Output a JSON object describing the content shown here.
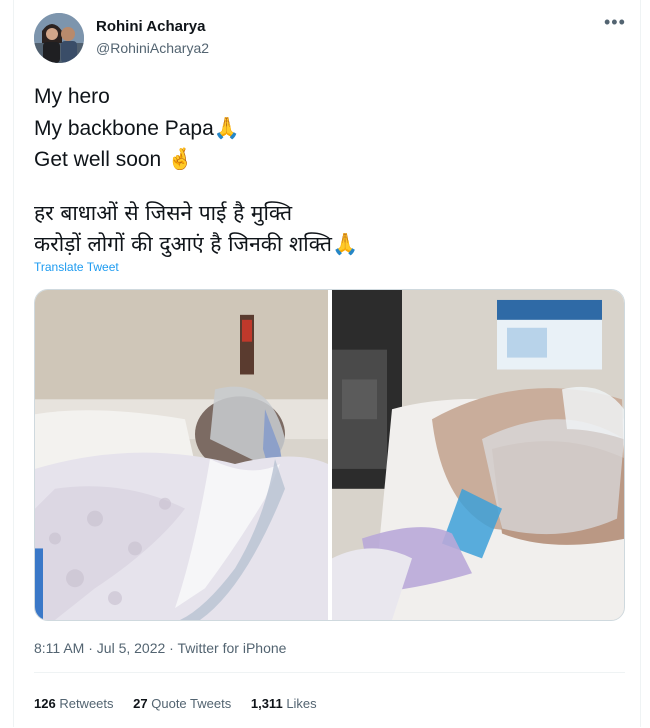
{
  "author": {
    "name": "Rohini Acharya",
    "handle": "@RohiniAcharya2"
  },
  "tweet": {
    "lines": [
      "My hero",
      "My backbone Papa",
      "Get well soon"
    ],
    "emoji": [
      "🙏",
      "🤞"
    ],
    "hindi_lines": [
      "हर बाधाओं से जिसने पाई है मुक्ति",
      "करोड़ों लोगों की दुआएं है जिनकी शक्ति"
    ],
    "hindi_emoji": "🙏",
    "translate_label": "Translate Tweet"
  },
  "meta": {
    "time": "8:11 AM",
    "date": "Jul 5, 2022",
    "sep": "·",
    "source": "Twitter for iPhone"
  },
  "stats": {
    "retweets": "126",
    "retweets_label": "Retweets",
    "quotes": "27",
    "quotes_label": "Quote Tweets",
    "likes": "1,311",
    "likes_label": "Likes"
  },
  "colors": {
    "link": "#1d9bf0",
    "secondary_text": "#536471",
    "divider": "#eff3f4"
  },
  "icons": [
    "more-options-icon",
    "folded-hands-emoji",
    "crossed-fingers-emoji"
  ]
}
